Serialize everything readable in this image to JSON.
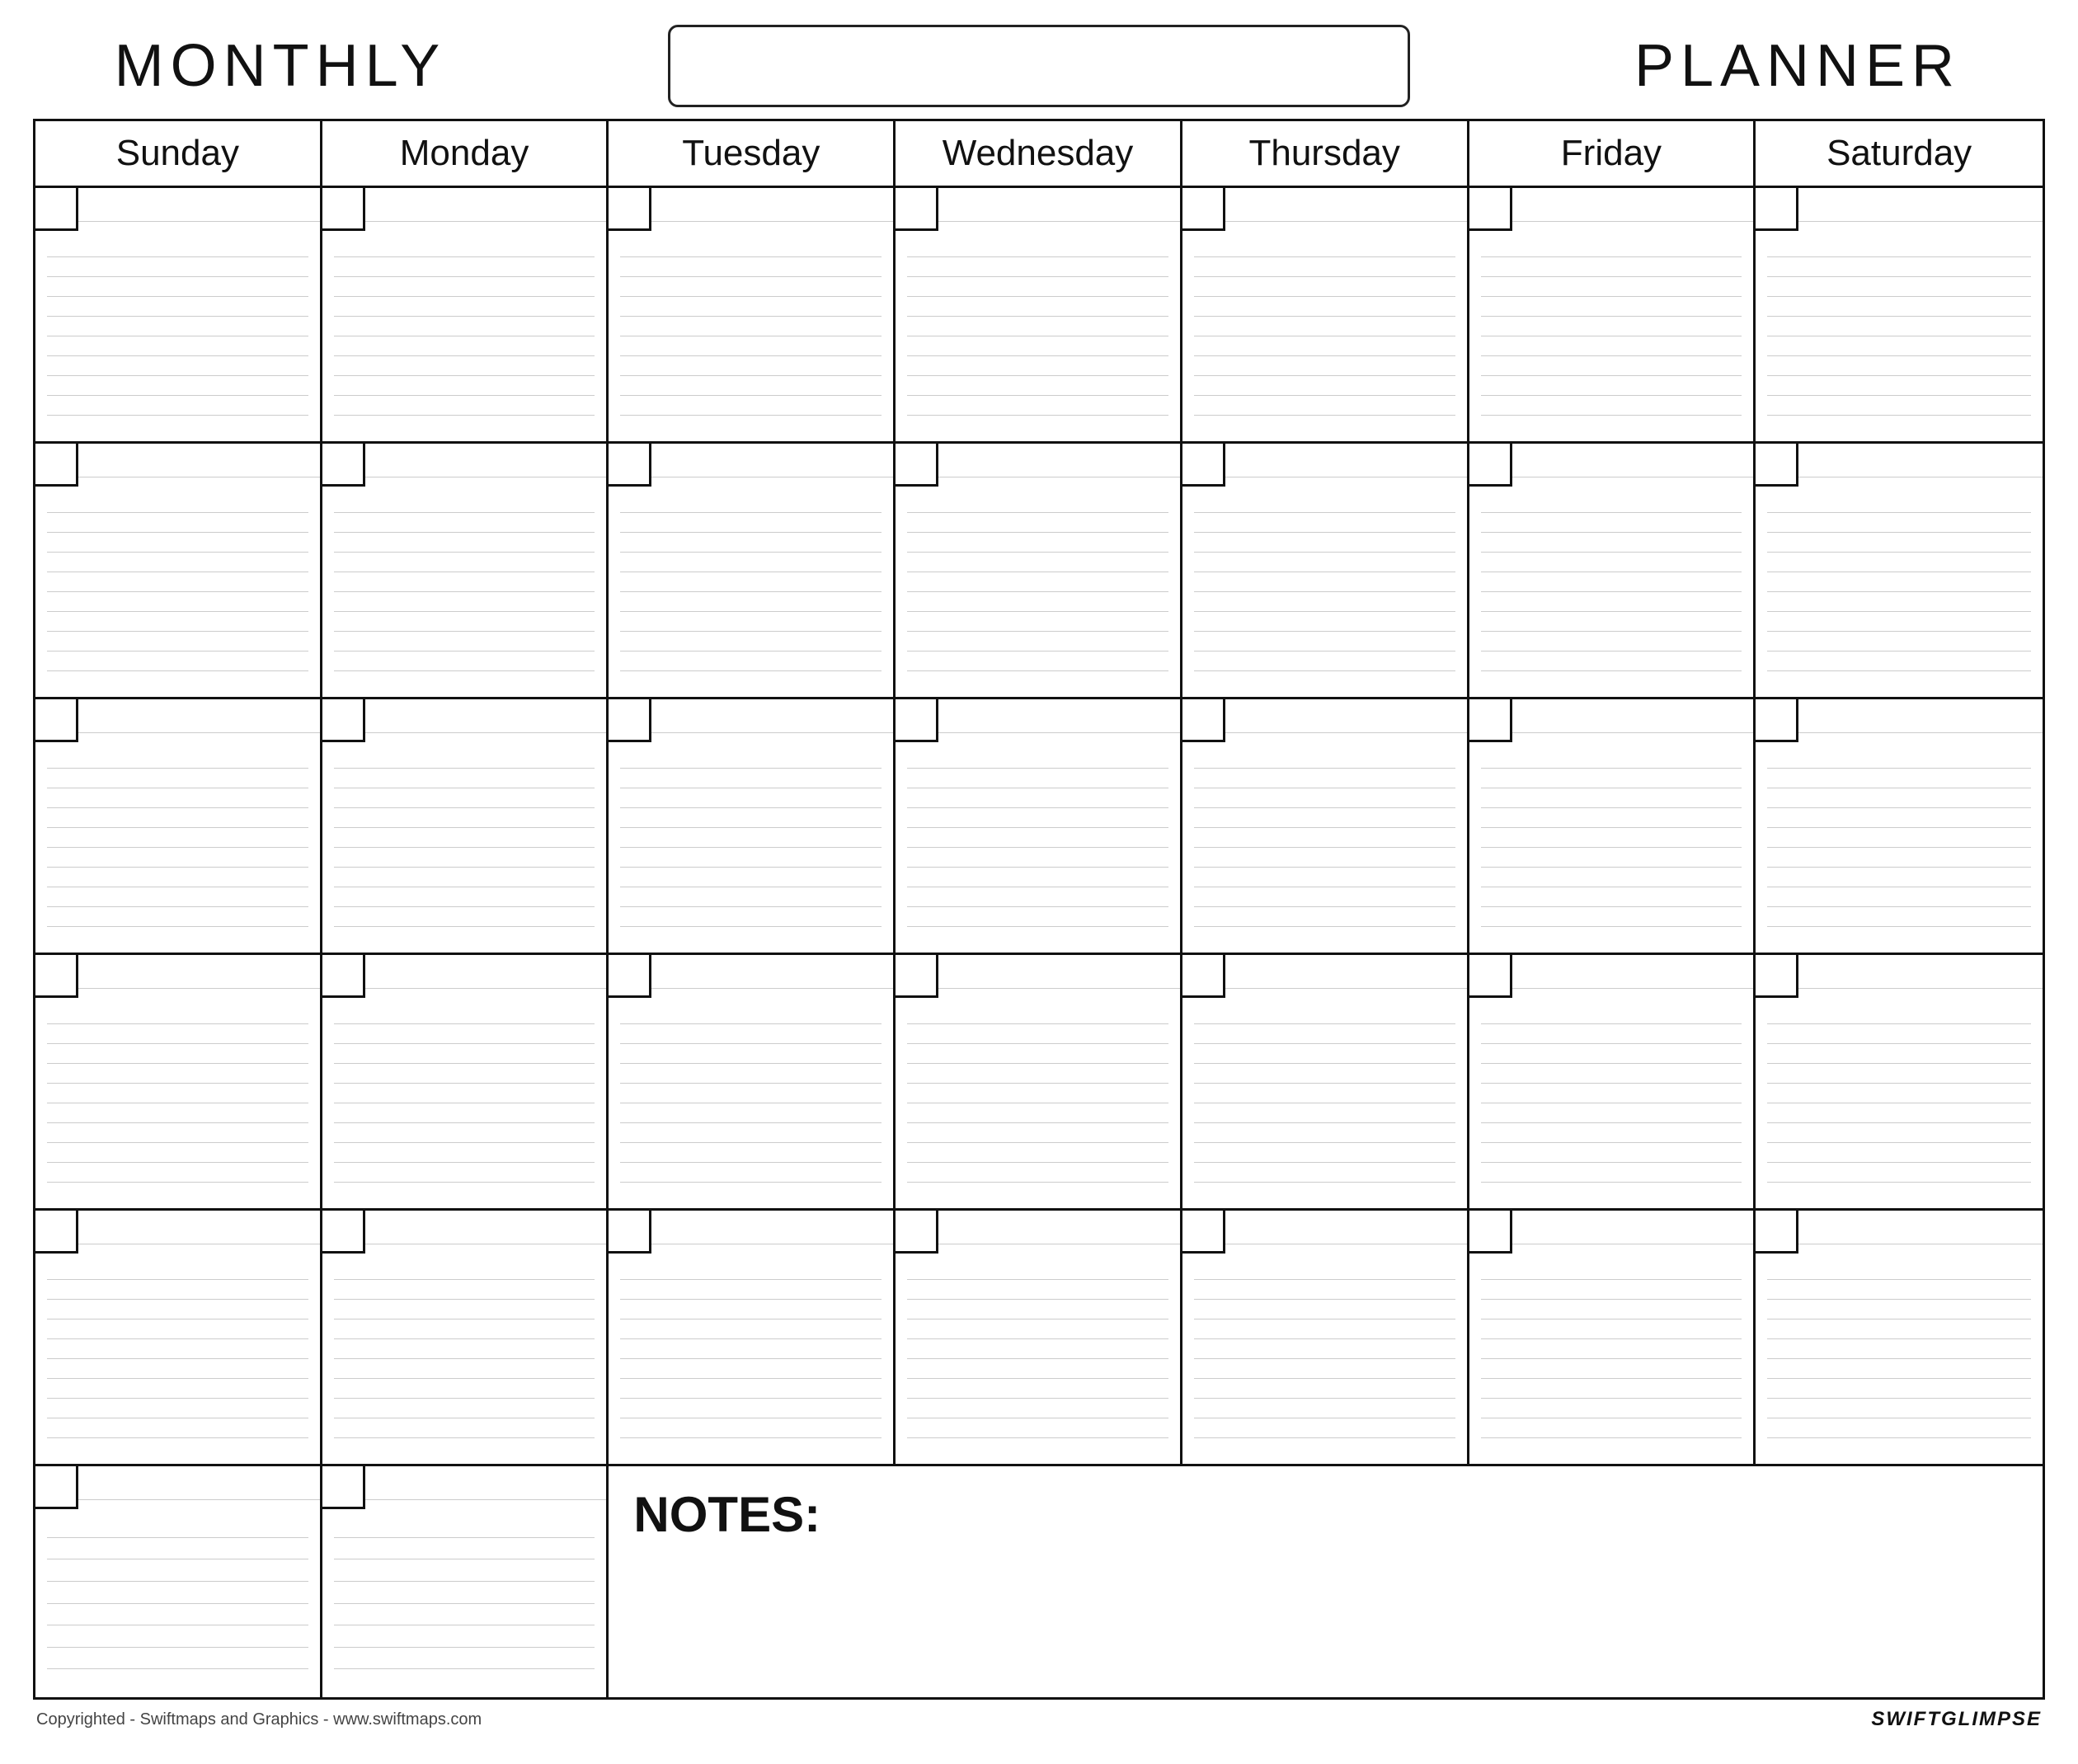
{
  "header": {
    "monthly_label": "MONTHLY",
    "planner_label": "PLANNER",
    "title_placeholder": ""
  },
  "days": {
    "headers": [
      "Sunday",
      "Monday",
      "Tuesday",
      "Wednesday",
      "Thursday",
      "Friday",
      "Saturday"
    ]
  },
  "weeks": {
    "count": 5,
    "lines_per_cell": 10
  },
  "notes": {
    "label": "NOTES:",
    "lines_per_cell": 8
  },
  "footer": {
    "copyright": "Copyrighted - Swiftmaps and Graphics - www.swiftmaps.com",
    "brand_swift": "SWIFT",
    "brand_glimpse": "GLIMPSE"
  }
}
